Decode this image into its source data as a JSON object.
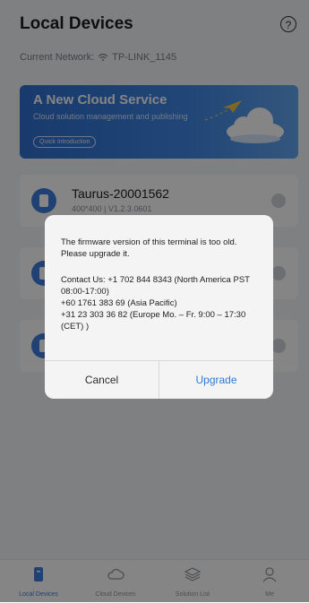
{
  "header": {
    "title": "Local Devices",
    "network_label": "Current Network:",
    "network_name": "TP-LINK_1145"
  },
  "banner": {
    "title": "A New Cloud Service",
    "subtitle": "Cloud solution management and publishing",
    "button_label": "Quick Introduction"
  },
  "devices": [
    {
      "name": "Taurus-20001562",
      "details": "400*400 | V1.2.3.0601"
    },
    {
      "name": "",
      "details": ""
    },
    {
      "name": "",
      "details": ""
    }
  ],
  "dialog": {
    "message": "The firmware version of this terminal is too old. Please upgrade it.",
    "contact_lines": [
      "Contact Us: +1 702 844 8343 (North America PST 08:00-17:00)",
      "+60 1761 383 69 (Asia Pacific)",
      "+31 23 303 36 82 (Europe Mo. – Fr. 9:00 – 17:30 (CET) )"
    ],
    "cancel_label": "Cancel",
    "upgrade_label": "Upgrade"
  },
  "tabs": [
    {
      "label": "Local Devices",
      "icon": "local-device-icon",
      "active": true
    },
    {
      "label": "Cloud Devices",
      "icon": "cloud-icon",
      "active": false
    },
    {
      "label": "Solution List",
      "icon": "layers-icon",
      "active": false
    },
    {
      "label": "Me",
      "icon": "person-icon",
      "active": false
    }
  ],
  "colors": {
    "accent": "#3d7ddd",
    "overlay": "rgba(0,0,0,0.48)"
  }
}
